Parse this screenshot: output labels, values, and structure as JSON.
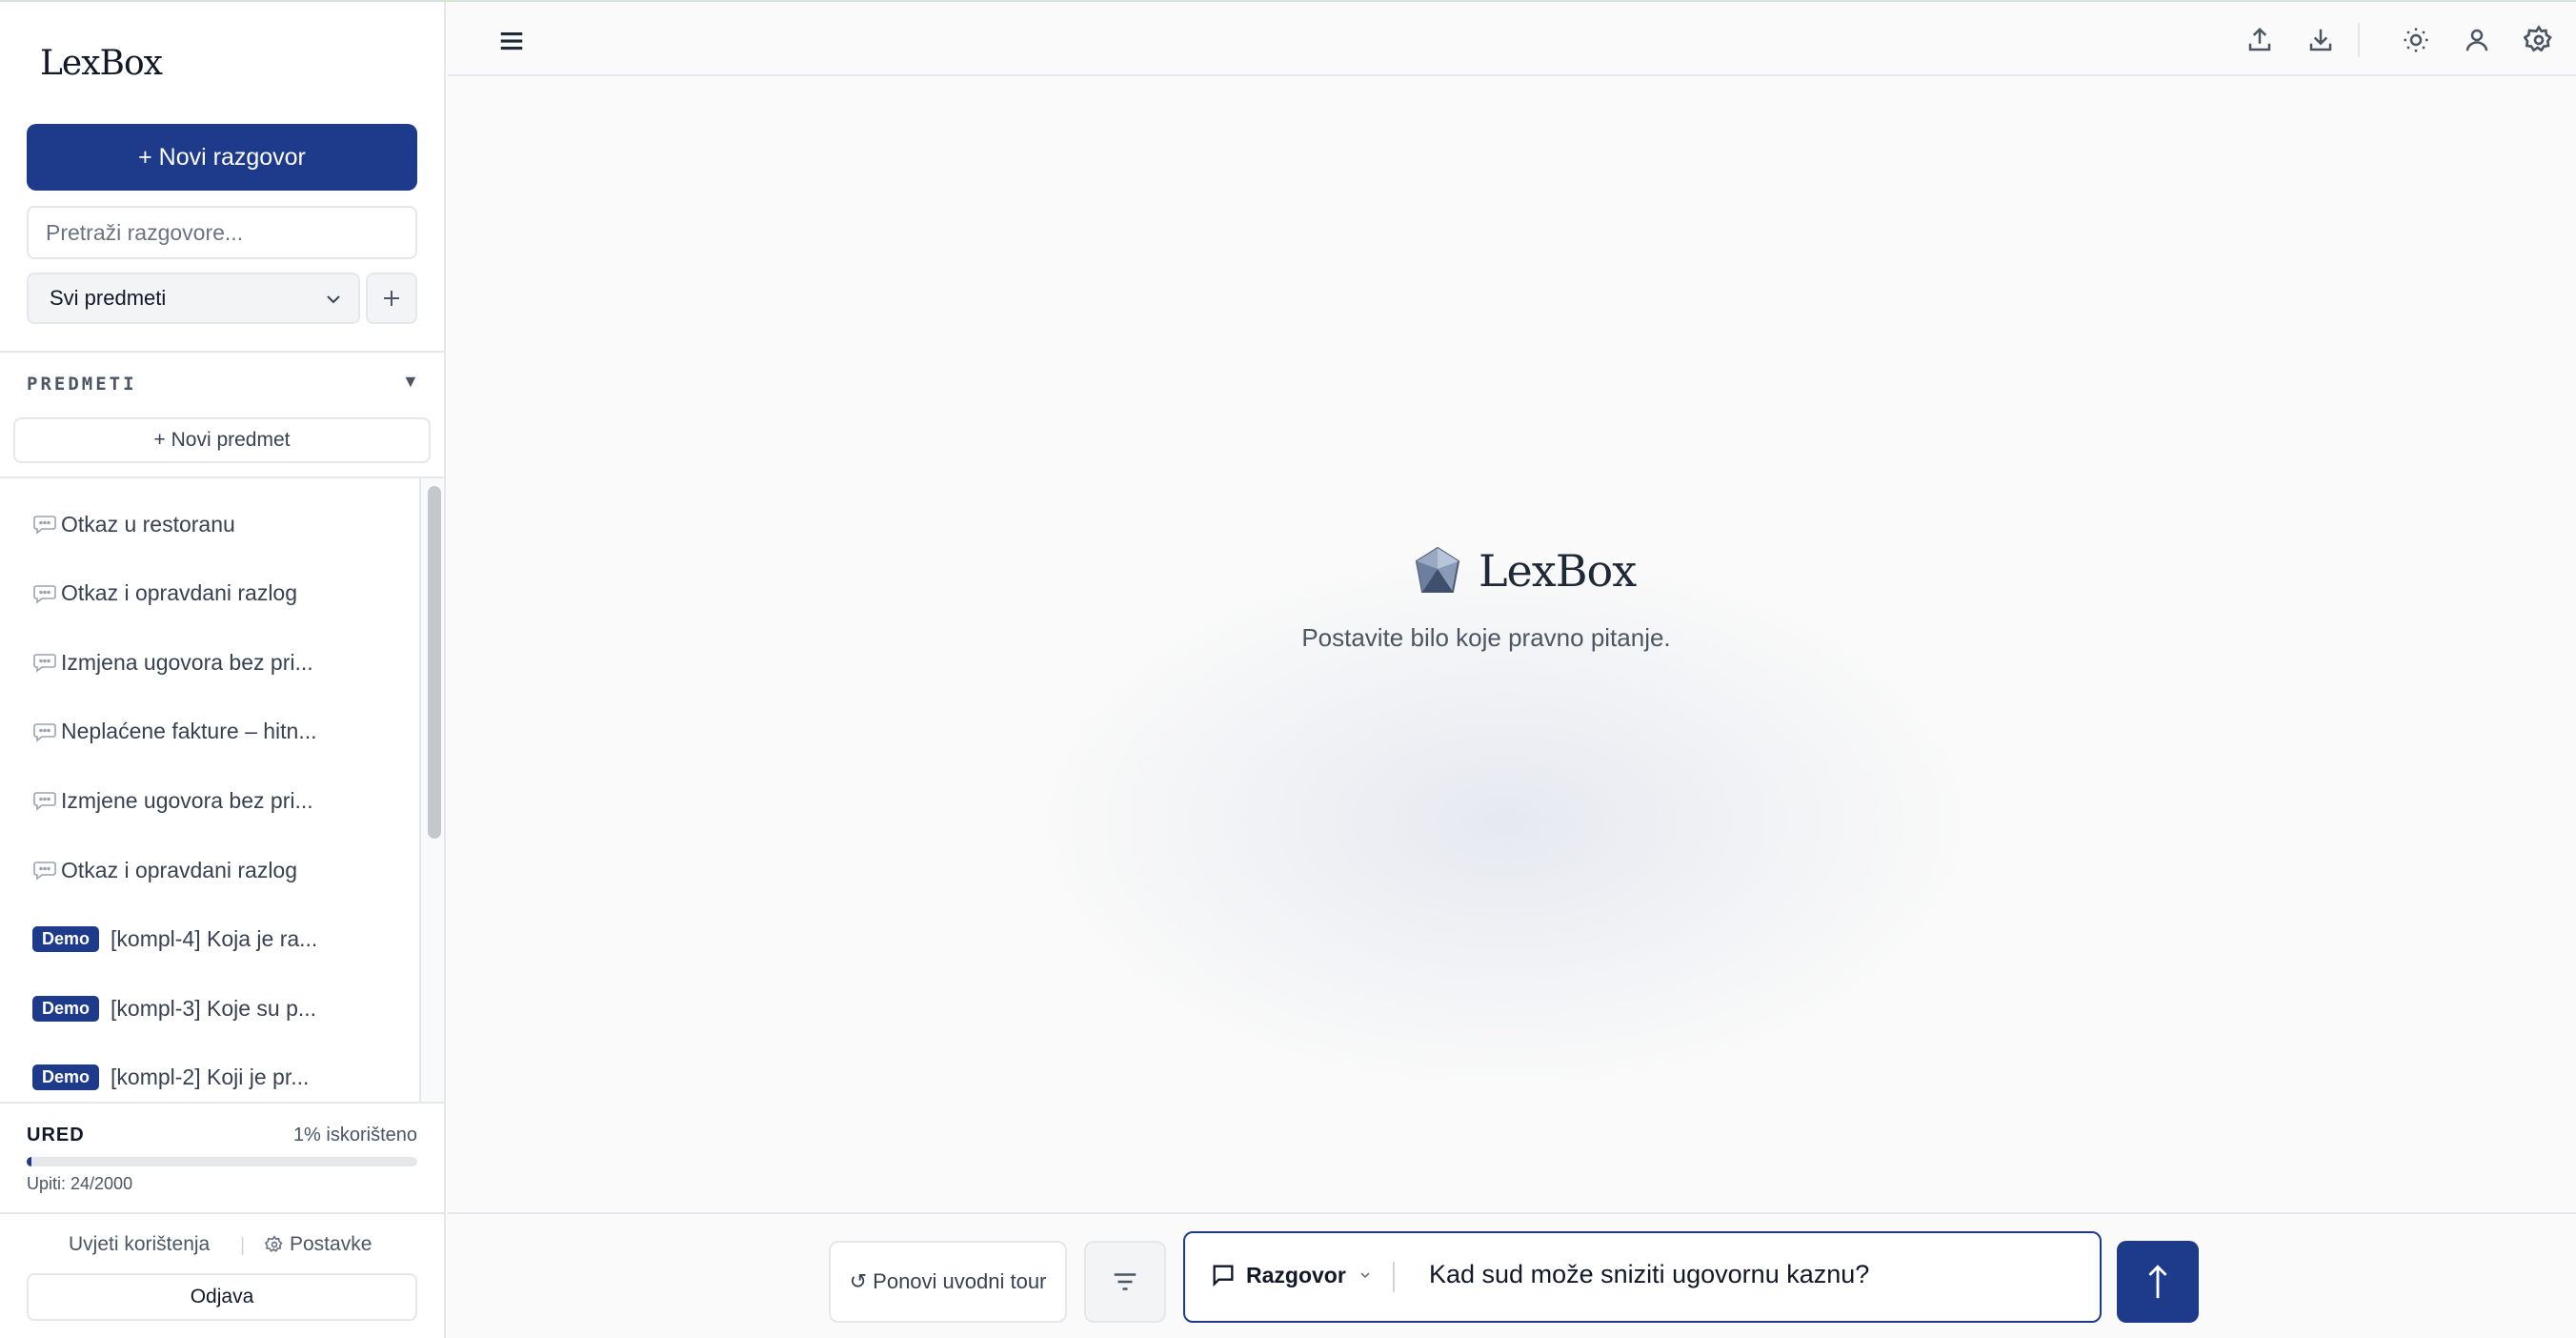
{
  "app": {
    "name": "LexBox"
  },
  "sidebar": {
    "new_chat_label": "+ Novi razgovor",
    "search_placeholder": "Pretraži razgovore...",
    "subject_filter": {
      "selected": "Svi predmeti"
    },
    "section_title": "PREDMETI",
    "section_toggle": "▼",
    "new_subject_label": "+ Novi predmet",
    "conversations": [
      {
        "title": "Otkaz u restoranu"
      },
      {
        "title": "Otkaz i opravdani razlog"
      },
      {
        "title": "Izmjena ugovora bez pri..."
      },
      {
        "title": "Neplaćene fakture – hitn..."
      },
      {
        "title": "Izmjene ugovora bez pri..."
      },
      {
        "title": "Otkaz i opravdani razlog"
      },
      {
        "badge": "Demo",
        "title": "[kompl-4] Koja je ra..."
      },
      {
        "badge": "Demo",
        "title": "[kompl-3] Koje su p..."
      },
      {
        "badge": "Demo",
        "title": "[kompl-2] Koji je pr..."
      }
    ],
    "usage": {
      "plan": "URED",
      "percent_label": "1% iskorišteno",
      "fraction": 0.012,
      "queries_label": "Upiti: 24/2000"
    },
    "footer": {
      "terms_label": "Uvjeti korištenja",
      "separator": "|",
      "settings_label": "Postavke",
      "logout_label": "Odjava"
    }
  },
  "topbar": {
    "icons": [
      "menu-icon",
      "upload-icon",
      "download-icon",
      "sun-icon",
      "user-icon",
      "settings-icon"
    ]
  },
  "main": {
    "hero_title": "LexBox",
    "hero_subtitle": "Postavite bilo koje pravno pitanje."
  },
  "composer": {
    "tour_label": "↺ Ponovi uvodni tour",
    "mode_label": "Razgovor",
    "input_value": "Kad sud može sniziti ugovornu kaznu?",
    "send_icon": "arrow-up-icon"
  },
  "colors": {
    "accent": "#1e3a8a",
    "border": "#e5e7eb",
    "background": "#fafafa"
  }
}
